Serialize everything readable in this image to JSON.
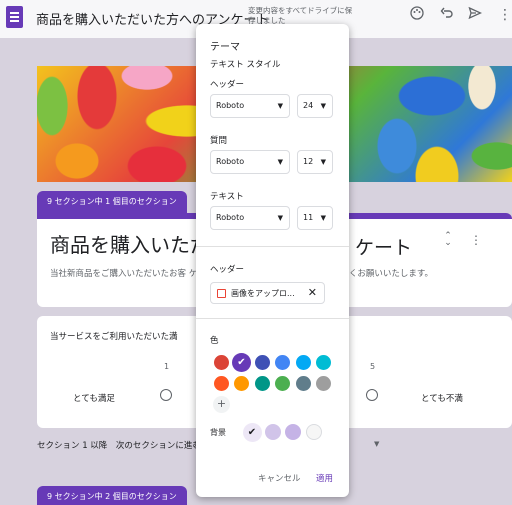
{
  "header": {
    "title": "商品を購入いただいた方へのアンケート",
    "save_status": "変更内容をすべてドライブに保存しました",
    "icons": [
      "palette-icon",
      "undo-icon",
      "send-icon",
      "more-icon"
    ]
  },
  "form": {
    "section1_tab": "9 セクション中 1 個目のセクション",
    "title": "商品を購入いただ",
    "title_tail": "ケート",
    "description": "当社新商品をご購入いただいたお客 ケートを実施しております。ご協力よろしくお願いいたします。",
    "question": "当サービスをご利用いただいた満",
    "scale_min_value": "1",
    "scale_max_value": "5",
    "scale_min_label": "とても満足",
    "scale_max_label": "とても不満",
    "after_section": "セクション 1 以降　次のセクションに進む",
    "section2_tab": "9 セクション中 2 個目のセクション"
  },
  "theme_dialog": {
    "title": "テーマ",
    "text_style_heading": "テキスト スタイル",
    "header_label": "ヘッダー",
    "header_font": "Roboto",
    "header_size": "24",
    "question_label": "質問",
    "question_font": "Roboto",
    "question_size": "12",
    "text_label": "テキスト",
    "text_font": "Roboto",
    "text_size": "11",
    "header_image_label": "ヘッダー",
    "header_image_file": "画像をアップロ...",
    "color_label": "色",
    "theme_colors": [
      "#db4437",
      "#673ab7",
      "#3f51b5",
      "#4285f4",
      "#03a9f4",
      "#00bcd4",
      "#ff5722",
      "#ff9800",
      "#009688",
      "#4caf50",
      "#607d8b",
      "#9e9e9e"
    ],
    "selected_color": "#673ab7",
    "background_label": "背景",
    "background_colors": [
      "#ede7f6",
      "#d1c4e9",
      "#c5b3e6",
      "#f6f6f6"
    ],
    "cancel_label": "キャンセル",
    "apply_label": "適用"
  }
}
